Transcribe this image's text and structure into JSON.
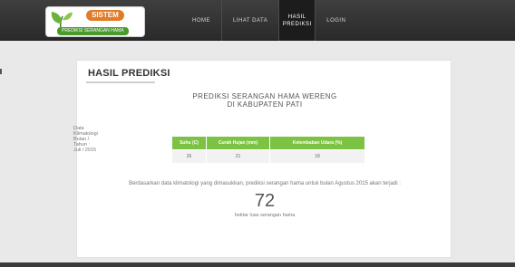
{
  "brand": {
    "title": "SISTEM",
    "subtitle": "PREDIKSI SERANGAN HAMA",
    "leaf_color": "#6bb33b",
    "accent_orange": "#e07b2a"
  },
  "nav": {
    "items": [
      {
        "label": "HOME"
      },
      {
        "label": "LIHAT DATA"
      },
      {
        "label": "HASIL PREDIKSI"
      },
      {
        "label": "LOGIN"
      }
    ],
    "active_index": 2
  },
  "page": {
    "heading": "HASIL PREDIKSI",
    "title_line1": "PREDIKSI SERANGAN HAMA WERENG",
    "title_line2": "DI KABUPATEN PATI",
    "meta": "Data Klimatologi Bulan / Tahun : Juli / 2015"
  },
  "table": {
    "headers": [
      "Suhu (C)",
      "Curah Hujan (mm)",
      "Kelembaban Udara (%)"
    ],
    "rows": [
      [
        "26",
        "21",
        "18"
      ]
    ],
    "header_color": "#7cc243"
  },
  "result": {
    "text": "Berdasarkan data klimatologi yang dimasukkan, prediksi serangan hama untuk bulan Agustus 2015 akan terjadi :",
    "value": "72",
    "unit": "hektar luas serangan hama"
  }
}
